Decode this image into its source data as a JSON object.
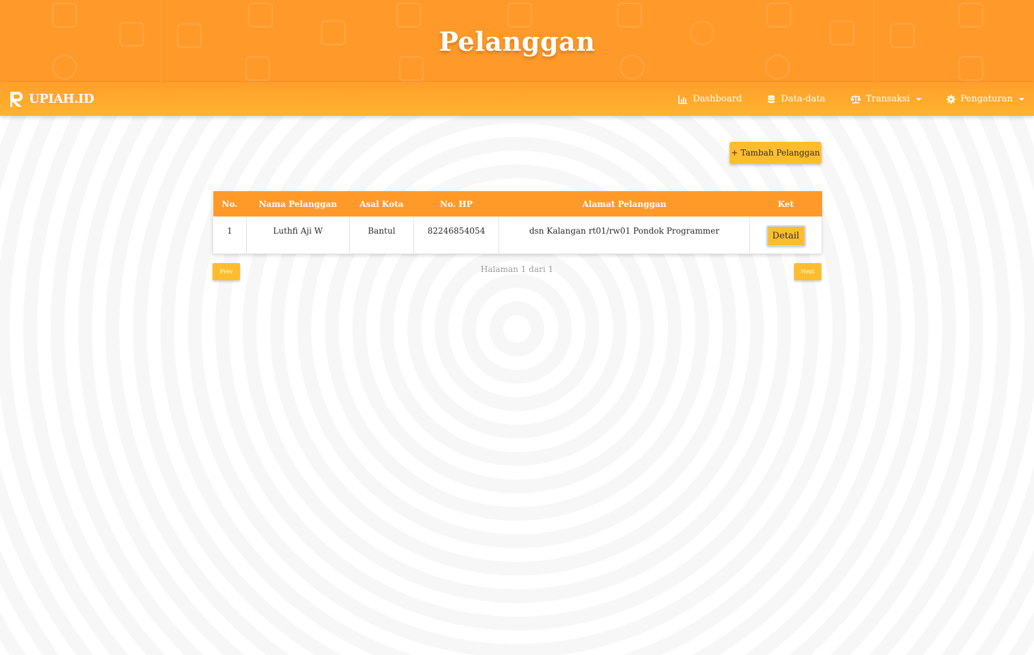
{
  "header": {
    "title": "Pelanggan"
  },
  "brand": {
    "name": "UPIAH.ID"
  },
  "nav": {
    "items": [
      {
        "label": "Dashboard",
        "icon": "bar-chart-icon",
        "dropdown": false
      },
      {
        "label": "Data-data",
        "icon": "database-icon",
        "dropdown": false
      },
      {
        "label": "Transaksi",
        "icon": "balance-scale-icon",
        "dropdown": true
      },
      {
        "label": "Pengaturan",
        "icon": "gear-icon",
        "dropdown": true
      }
    ]
  },
  "actions": {
    "add_label": "+ Tambah Pelanggan"
  },
  "table": {
    "columns": [
      "No.",
      "Nama Pelanggan",
      "Asal Kota",
      "No. HP",
      "Alamat Pelanggan",
      "Ket"
    ],
    "rows": [
      {
        "no": "1",
        "nama": "Luthfi Aji W",
        "kota": "Bantul",
        "hp": "82246854054",
        "alamat": "dsn Kalangan rt01/rw01 Pondok Programmer",
        "ket_label": "Detail"
      }
    ]
  },
  "pagination": {
    "prev_label": "Prev",
    "next_label": "Next",
    "info": "Halaman 1 dari 1"
  },
  "colors": {
    "primary": "#ff9a2a",
    "button": "#ffbd2e"
  }
}
